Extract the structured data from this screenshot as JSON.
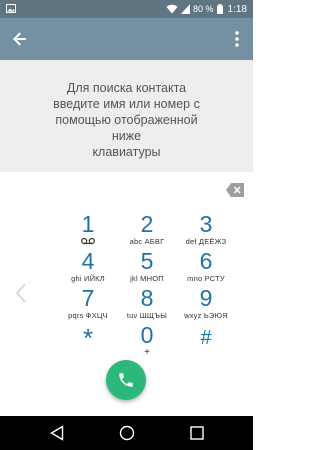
{
  "status_bar": {
    "battery_percent": "80 %",
    "time": "1:18"
  },
  "toolbar": {
    "back_icon": "arrow-back-icon",
    "more_icon": "more-vert-icon"
  },
  "info": {
    "text": "Для поиска контакта\nвведите имя или номер с\nпомощью отображенной ниже\nклавиатуры"
  },
  "dialpad": {
    "keys": [
      {
        "digit": "1",
        "letters": "",
        "extra": "voicemail-icon"
      },
      {
        "digit": "2",
        "letters": "abc  АБВГ"
      },
      {
        "digit": "3",
        "letters": "def  ДЕЁЖЗ"
      },
      {
        "digit": "4",
        "letters": "ghi  ИЙКЛ"
      },
      {
        "digit": "5",
        "letters": "jkl  МНОП"
      },
      {
        "digit": "6",
        "letters": "mno  РСТУ"
      },
      {
        "digit": "7",
        "letters": "pqrs  ФХЦЧ"
      },
      {
        "digit": "8",
        "letters": "tuv  ШЩЪЫ"
      },
      {
        "digit": "9",
        "letters": "wxyz  ЬЭЮЯ"
      },
      {
        "digit": "*",
        "letters": ""
      },
      {
        "digit": "0",
        "letters": "+"
      },
      {
        "digit": "#",
        "letters": ""
      }
    ]
  },
  "colors": {
    "status_bar": "#5f7682",
    "toolbar": "#7590a0",
    "digit": "#1f73a4",
    "call_button": "#2cb77b"
  }
}
